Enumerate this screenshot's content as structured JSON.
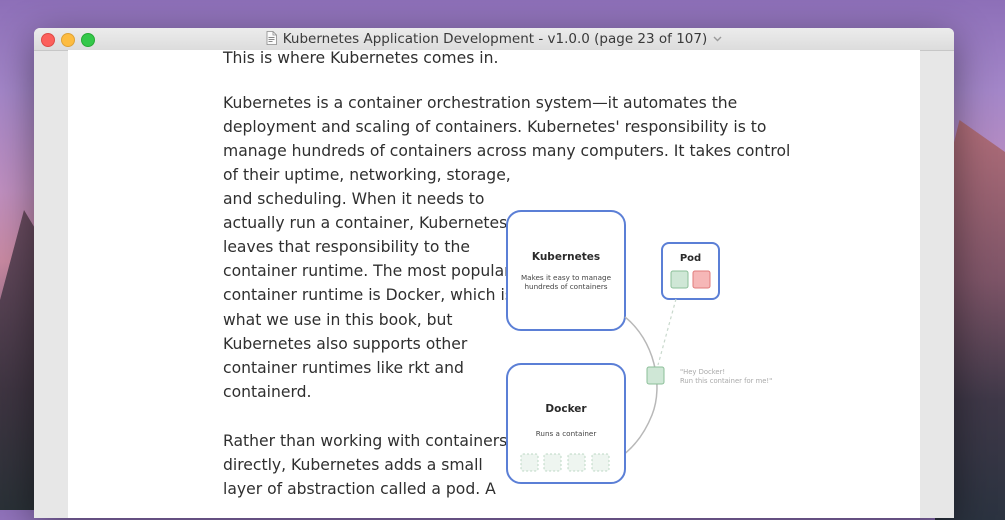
{
  "window": {
    "title": "Kubernetes Application Development - v1.0.0 (page 23 of 107)"
  },
  "document": {
    "lines_top": [
      "This is where Kubernetes comes in."
    ],
    "paragraph_wide": [
      "Kubernetes is a container orchestration system—it automates the",
      "deployment and scaling of containers. Kubernetes' responsibility is to",
      "manage hundreds of containers across many computers. It takes control"
    ],
    "paragraph_narrow": [
      "of their uptime, networking, storage,",
      "and scheduling. When it needs to",
      "actually run a container, Kubernetes",
      "leaves that responsibility to the",
      "container runtime. The most popular",
      "container runtime is Docker, which is",
      "what we use in this book, but",
      "Kubernetes also supports other",
      "container runtimes like rkt and",
      "containerd."
    ],
    "paragraph_bottom": [
      "Rather than working with containers",
      "directly, Kubernetes adds a small",
      "layer of abstraction called a pod. A"
    ]
  },
  "diagram": {
    "kubernetes_title": "Kubernetes",
    "kubernetes_desc_1": "Makes it easy to manage",
    "kubernetes_desc_2": "hundreds of containers",
    "pod_title": "Pod",
    "docker_title": "Docker",
    "docker_desc": "Runs a container",
    "note_1": "\"Hey Docker!",
    "note_2": "Run this container for me!\""
  },
  "colors": {
    "box_border": "#5b7fd6",
    "green_fill": "#cfe7d6",
    "red_fill": "#f6b7b7",
    "arrow": "#b8b8b8"
  }
}
